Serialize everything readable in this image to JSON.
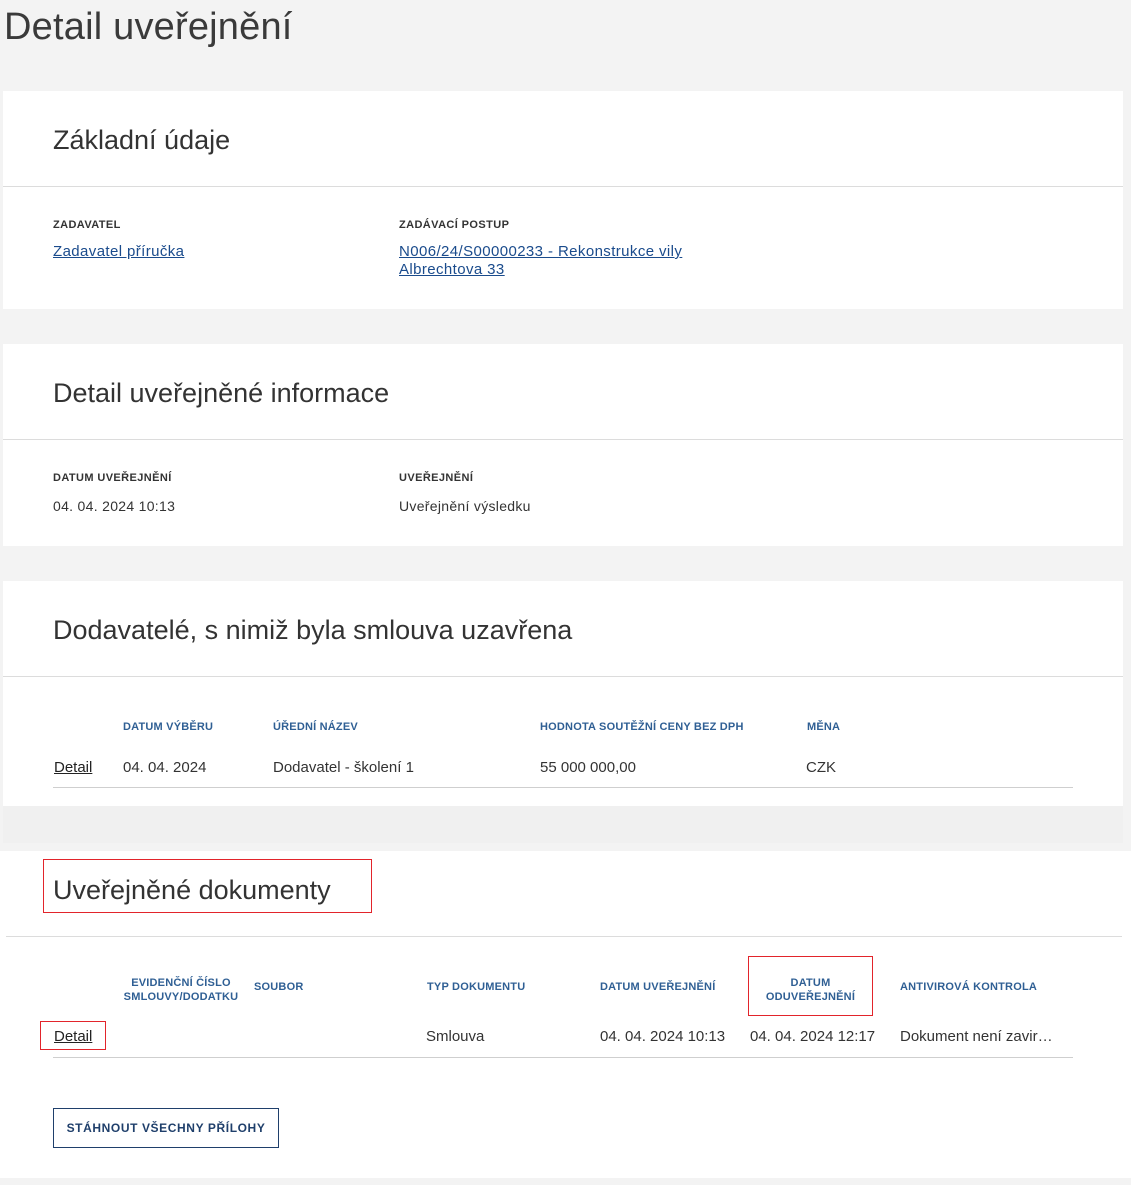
{
  "page": {
    "title": "Detail uveřejnění"
  },
  "basic_info": {
    "title": "Základní údaje",
    "zadavatel_label": "ZADAVATEL",
    "zadavatel_value": "Zadavatel příručka",
    "postup_label": "ZADÁVACÍ POSTUP",
    "postup_value_line1": "N006/24/S00000233 - Rekonstrukce vily",
    "postup_value_line2": "Albrechtova 33"
  },
  "publication_info": {
    "title": "Detail uveřejněné informace",
    "datum_label": "DATUM UVEŘEJNĚNÍ",
    "datum_value": "04. 04. 2024 10:13",
    "uverejneni_label": "UVEŘEJNĚNÍ",
    "uverejneni_value": "Uveřejnění výsledku"
  },
  "suppliers": {
    "title": "Dodavatelé, s nimiž byla smlouva uzavřena",
    "columns": [
      "DATUM VÝBĚRU",
      "ÚŘEDNÍ NÁZEV",
      "HODNOTA SOUTĚŽNÍ CENY BEZ DPH",
      "MĚNA"
    ],
    "rows": [
      {
        "link": "Detail",
        "datum": "04. 04. 2024",
        "nazev": "Dodavatel - školení 1",
        "hodnota": "55 000 000,00",
        "mena": "CZK"
      }
    ]
  },
  "documents": {
    "title": "Uveřejněné dokumenty",
    "columns": {
      "evidencni_line1": "EVIDENČNÍ ČÍSLO",
      "evidencni_line2": "SMLOUVY/DODATKU",
      "soubor": "SOUBOR",
      "typ": "TYP DOKUMENTU",
      "datum_uverejneni": "DATUM UVEŘEJNĚNÍ",
      "datum_oduverejneni_line1": "DATUM",
      "datum_oduverejneni_line2": "ODUVEŘEJNĚNÍ",
      "antivir": "ANTIVIROVÁ KONTROLA"
    },
    "rows": [
      {
        "link": "Detail",
        "typ": "Smlouva",
        "datum_uverejneni": "04. 04. 2024 10:13",
        "datum_oduverejneni": "04. 04. 2024 12:17",
        "antivir": "Dokument není zaviro…"
      }
    ],
    "download_button": "STÁHNOUT VŠECHNY PŘÍLOHY"
  }
}
